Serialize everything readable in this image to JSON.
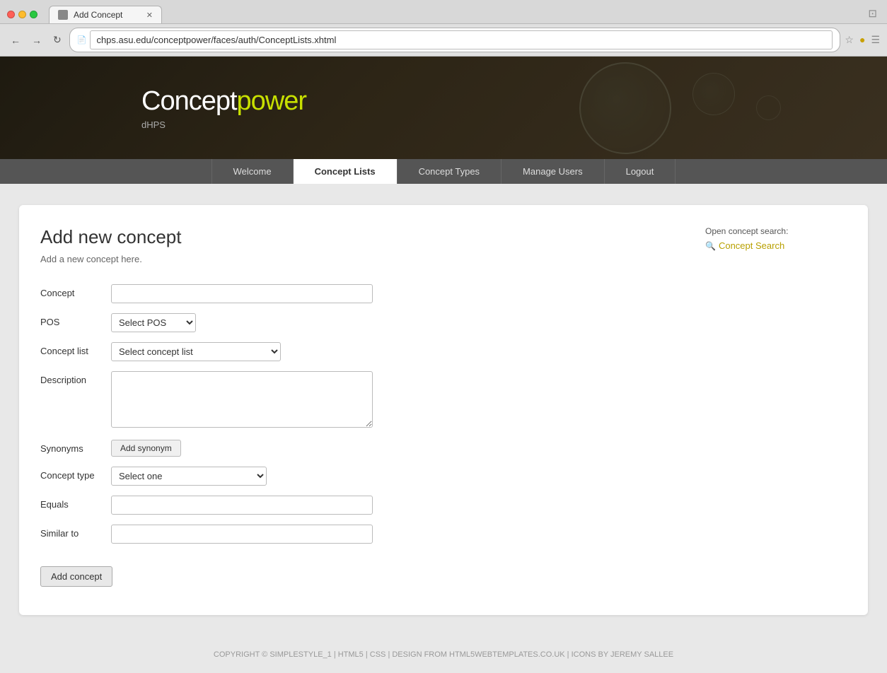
{
  "browser": {
    "dots": [
      "close",
      "minimize",
      "maximize"
    ],
    "tab_title": "Add Concept",
    "url": "chps.asu.edu/conceptpower/faces/auth/ConceptLists.xhtml"
  },
  "header": {
    "logo_text_plain": "Concept",
    "logo_text_accent": "power",
    "logo_sub": "dHPS"
  },
  "nav": {
    "items": [
      {
        "id": "welcome",
        "label": "Welcome",
        "active": false
      },
      {
        "id": "concept-lists",
        "label": "Concept Lists",
        "active": true
      },
      {
        "id": "concept-types",
        "label": "Concept Types",
        "active": false
      },
      {
        "id": "manage-users",
        "label": "Manage Users",
        "active": false
      },
      {
        "id": "logout",
        "label": "Logout",
        "active": false
      }
    ]
  },
  "page": {
    "title": "Add new concept",
    "subtitle": "Add a new concept here."
  },
  "form": {
    "concept_label": "Concept",
    "pos_label": "POS",
    "pos_placeholder": "Select POS",
    "concept_list_label": "Concept list",
    "concept_list_placeholder": "Select concept list",
    "description_label": "Description",
    "synonyms_label": "Synonyms",
    "add_synonym_btn": "Add synonym",
    "concept_type_label": "Concept type",
    "concept_type_placeholder": "Select one",
    "equals_label": "Equals",
    "similar_to_label": "Similar to",
    "add_concept_btn": "Add concept"
  },
  "sidebar": {
    "open_search_label": "Open concept search:",
    "concept_search_link": "Concept Search"
  },
  "footer": {
    "text": "COPYRIGHT © SIMPLESTYLE_1 | HTML5 | CSS | DESIGN FROM HTML5WEBTEMPLATES.CO.UK | ICONS BY JEREMY SALLEE"
  }
}
